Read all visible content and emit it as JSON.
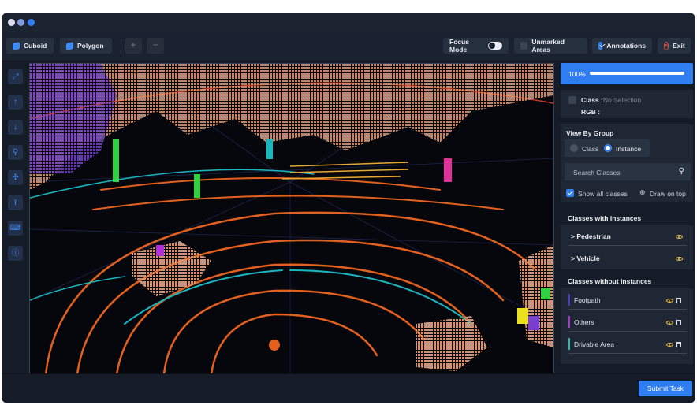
{
  "toolbar": {
    "cuboid_label": "Cuboid",
    "polygon_label": "Polygon",
    "plus_label": "+",
    "minus_label": "−",
    "focus_mode_label": "Focus Mode",
    "unmarked_areas_label": "Unmarked Areas",
    "annotations_label": "Annotations",
    "exit_label": "Exit",
    "focus_mode_on": false,
    "unmarked_areas_checked": false,
    "annotations_checked": true
  },
  "left_tools": [
    "cursor-icon",
    "arrow-up-icon",
    "arrow-down-icon",
    "zoom-icon",
    "fit-icon",
    "upload-icon",
    "keyboard-icon",
    "info-icon"
  ],
  "panel": {
    "progress": {
      "label": "100%",
      "value": 1.0
    },
    "class_label": "Class :",
    "class_value": "No Selection",
    "rgb_label": "RGB :",
    "view_by_group": "View By Group",
    "group_options": [
      {
        "label": "Class",
        "selected": false
      },
      {
        "label": "Instance",
        "selected": true
      }
    ],
    "search_placeholder": "Search Classes",
    "show_all_label": "Show all classes",
    "draw_on_top_label": "Draw on top",
    "with_instances_title": "Classes with instances",
    "with_instances": [
      {
        "label": "Pedestrian"
      },
      {
        "label": "Vehicle"
      }
    ],
    "without_instances_title": "Classes without instances",
    "without_instances": [
      {
        "label": "Footpath",
        "color": "#4b3ad8"
      },
      {
        "label": "Others",
        "color": "#b02fd8"
      },
      {
        "label": "Drivable Area",
        "color": "#18c6b0"
      }
    ]
  },
  "footer": {
    "submit_label": "Submit Task"
  }
}
